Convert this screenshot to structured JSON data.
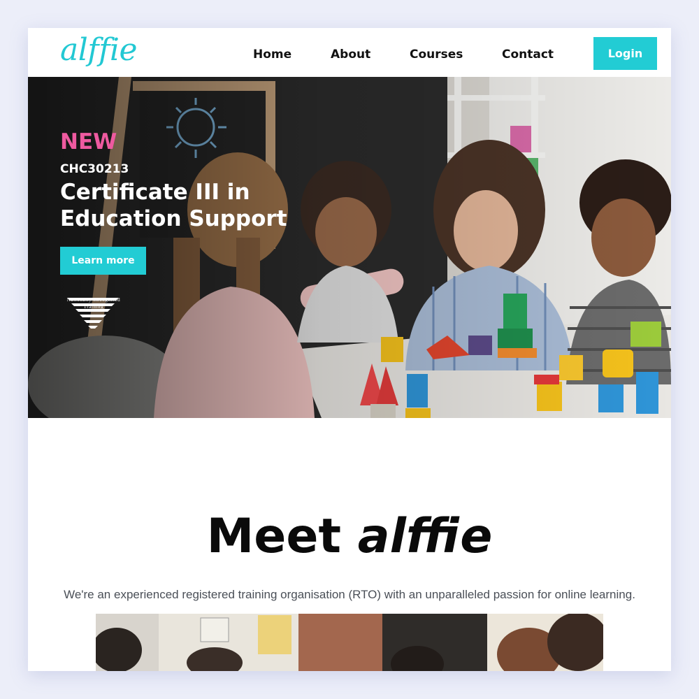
{
  "header": {
    "logo": "alffie",
    "nav": [
      "Home",
      "About",
      "Courses",
      "Contact"
    ],
    "login_label": "Login"
  },
  "hero": {
    "tag": "NEW",
    "course_code": "CHC30213",
    "course_title": "Certificate III in Education Support",
    "cta_label": "Learn more",
    "nrt_text": "Nationally Recognised Training",
    "image_alt": "teacher-with-children-playing-with-blocks"
  },
  "meet": {
    "title_prefix": "Meet",
    "title_brand": "alffie",
    "subtitle": "We're an experienced registered training organisation (RTO) with an unparalleled passion for online learning.",
    "image_alt": "group-of-people-in-office"
  },
  "colors": {
    "accent": "#22ccd4",
    "new_tag": "#ef5aa0",
    "background": "#eceef9"
  }
}
